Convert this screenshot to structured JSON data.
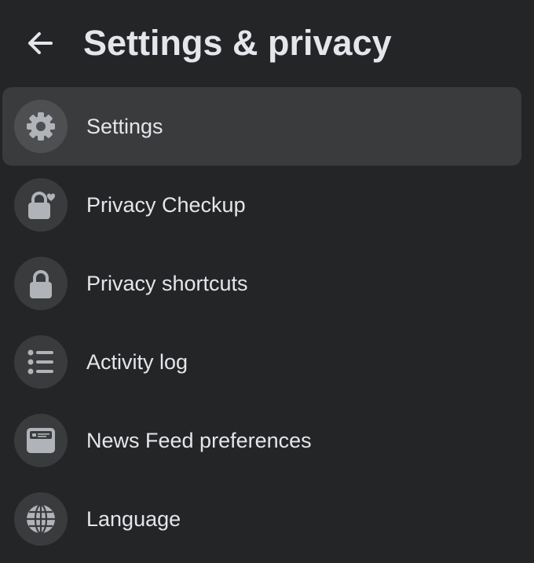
{
  "header": {
    "title": "Settings & privacy",
    "back_icon": "arrow-left-icon"
  },
  "colors": {
    "background": "#242526",
    "active_item": "#3a3b3c",
    "icon_circle": "#3a3b3c",
    "icon_fill": "#b0b3b8",
    "text": "#e4e6eb"
  },
  "menu": {
    "items": [
      {
        "label": "Settings",
        "icon": "gear-icon",
        "active": true
      },
      {
        "label": "Privacy Checkup",
        "icon": "lock-heart-icon",
        "active": false
      },
      {
        "label": "Privacy shortcuts",
        "icon": "lock-icon",
        "active": false
      },
      {
        "label": "Activity log",
        "icon": "list-icon",
        "active": false
      },
      {
        "label": "News Feed preferences",
        "icon": "news-feed-icon",
        "active": false
      },
      {
        "label": "Language",
        "icon": "globe-icon",
        "active": false
      }
    ]
  }
}
